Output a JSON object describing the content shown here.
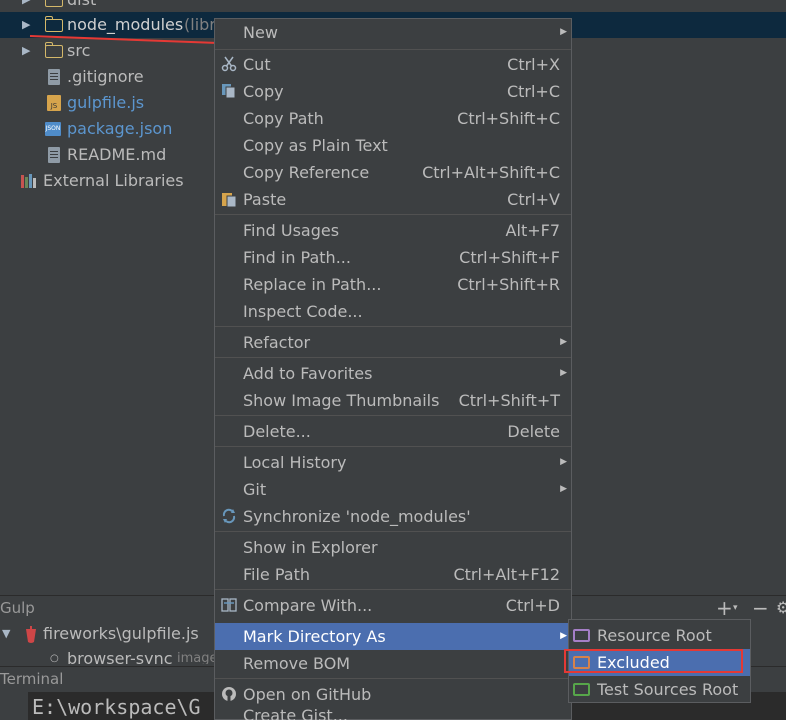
{
  "project_tree": {
    "items": [
      {
        "label": "dist"
      },
      {
        "label": "node_modules",
        "suffix": "(libra"
      },
      {
        "label": "src"
      },
      {
        "label": ".gitignore"
      },
      {
        "label": "gulpfile.js"
      },
      {
        "label": "package.json"
      },
      {
        "label": "README.md"
      },
      {
        "label": "External Libraries"
      }
    ]
  },
  "gulp_panel": {
    "title": "Gulp",
    "add_label": "+",
    "minus_label": "−",
    "tree": {
      "root": "fireworks\\gulpfile.js",
      "child": "browser-sync",
      "child_suffix": "image"
    }
  },
  "terminal_panel": {
    "title": "Terminal",
    "prompt": "E:\\workspace\\G"
  },
  "context_menu": {
    "items": [
      {
        "label": "New",
        "shortcut": "",
        "submenu": true
      },
      {
        "label": "Cut",
        "shortcut": "Ctrl+X",
        "icon": "scissors-icon"
      },
      {
        "label": "Copy",
        "shortcut": "Ctrl+C",
        "icon": "copy-icon"
      },
      {
        "label": "Copy Path",
        "shortcut": "Ctrl+Shift+C"
      },
      {
        "label": "Copy as Plain Text",
        "shortcut": ""
      },
      {
        "label": "Copy Reference",
        "shortcut": "Ctrl+Alt+Shift+C"
      },
      {
        "label": "Paste",
        "shortcut": "Ctrl+V",
        "icon": "paste-icon"
      },
      {
        "label": "Find Usages",
        "shortcut": "Alt+F7"
      },
      {
        "label": "Find in Path...",
        "shortcut": "Ctrl+Shift+F"
      },
      {
        "label": "Replace in Path...",
        "shortcut": "Ctrl+Shift+R"
      },
      {
        "label": "Inspect Code...",
        "shortcut": ""
      },
      {
        "label": "Refactor",
        "shortcut": "",
        "submenu": true
      },
      {
        "label": "Add to Favorites",
        "shortcut": "",
        "submenu": true
      },
      {
        "label": "Show Image Thumbnails",
        "shortcut": "Ctrl+Shift+T"
      },
      {
        "label": "Delete...",
        "shortcut": "Delete"
      },
      {
        "label": "Local History",
        "shortcut": "",
        "submenu": true
      },
      {
        "label": "Git",
        "shortcut": "",
        "submenu": true
      },
      {
        "label": "Synchronize 'node_modules'",
        "shortcut": "",
        "icon": "sync-icon"
      },
      {
        "label": "Show in Explorer",
        "shortcut": ""
      },
      {
        "label": "File Path",
        "shortcut": "Ctrl+Alt+F12"
      },
      {
        "label": "Compare With...",
        "shortcut": "Ctrl+D",
        "icon": "compare-icon"
      },
      {
        "label": "Mark Directory As",
        "shortcut": "",
        "submenu": true,
        "active": true
      },
      {
        "label": "Remove BOM",
        "shortcut": ""
      },
      {
        "label": "Open on GitHub",
        "shortcut": "",
        "icon": "github-icon"
      },
      {
        "label": "Create Gist...",
        "shortcut": ""
      }
    ]
  },
  "mark_directory_submenu": {
    "items": [
      {
        "label": "Resource Root",
        "color": "#a57fc7"
      },
      {
        "label": "Excluded",
        "color": "#d6824b",
        "active": true
      },
      {
        "label": "Test Sources Root",
        "color": "#57a64a"
      }
    ]
  },
  "colors": {
    "background": "#3c3f41",
    "selection": "#4b6eaf",
    "annotation_red": "#e53935"
  }
}
